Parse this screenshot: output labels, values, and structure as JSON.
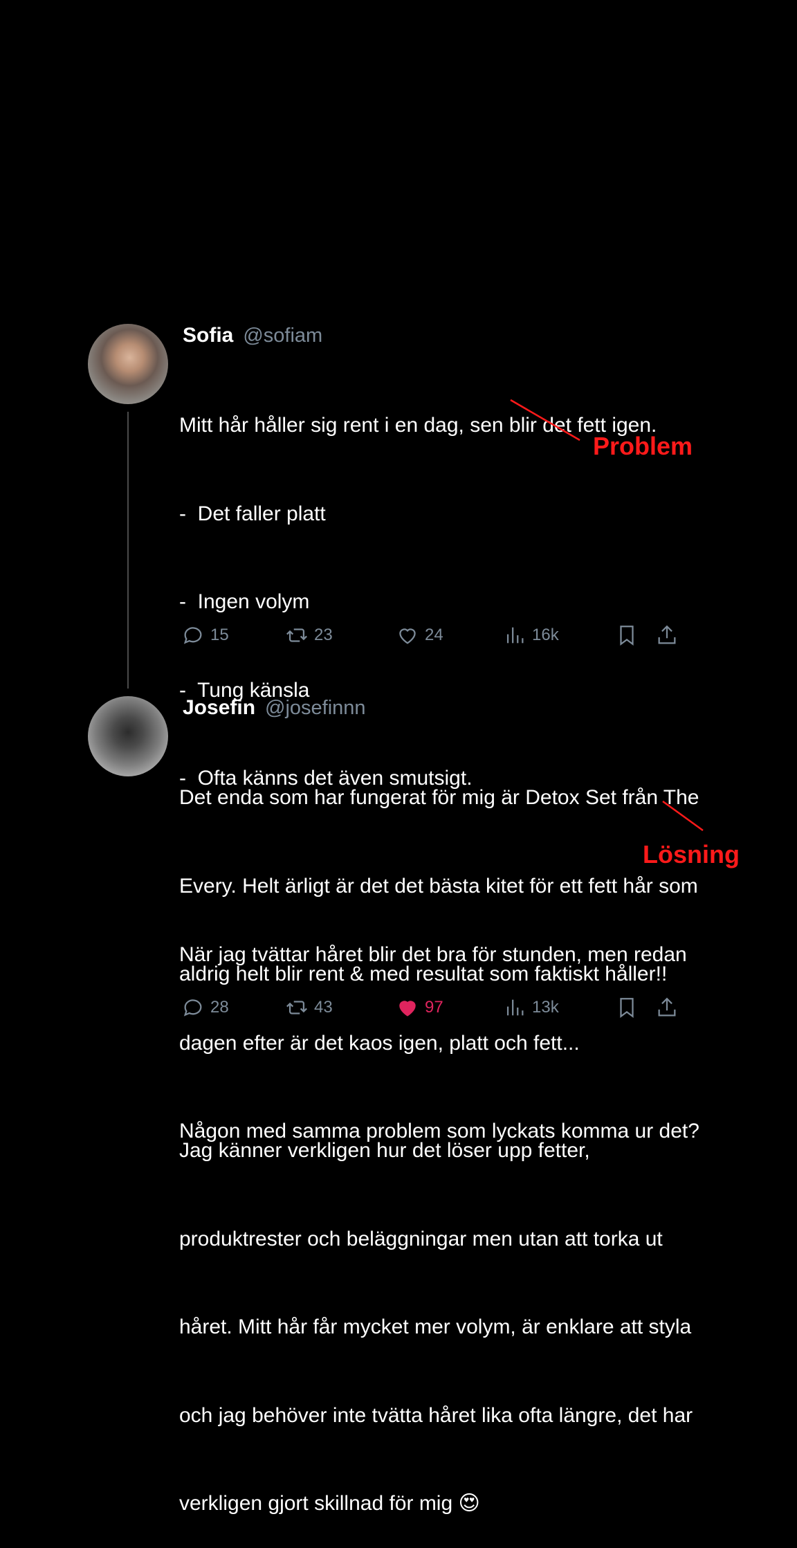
{
  "tweet1": {
    "name": "Sofia",
    "handle": "@sofiam",
    "lines": [
      "Mitt hår håller sig rent i en dag, sen blir det fett igen.",
      "-  Det faller platt",
      "-  Ingen volym",
      "-  Tung känsla",
      "-  Ofta känns det även smutsigt.",
      "",
      "När jag tvättar håret blir det bra för stunden, men redan",
      "dagen efter är det kaos igen, platt och fett...",
      "Någon med samma problem som lyckats komma ur det?"
    ],
    "replies": "15",
    "retweets": "23",
    "likes": "24",
    "views": "16k"
  },
  "tweet2": {
    "name": "Josefin",
    "handle": "@josefinnn",
    "lines": [
      "Det enda som har fungerat för mig är Detox Set från The",
      "Every. Helt ärligt är det det bästa kitet för ett fett hår som",
      "aldrig helt blir rent & med resultat som faktiskt håller!!",
      "",
      "Jag känner verkligen hur det löser upp fetter,",
      "produktrester och beläggningar men utan att torka ut",
      "håret. Mitt hår får mycket mer volym, är enklare att styla",
      "och jag behöver inte tvätta håret lika ofta längre, det har",
      "verkligen gjort skillnad för mig 😍"
    ],
    "replies": "28",
    "retweets": "43",
    "likes": "97",
    "views": "13k"
  },
  "annotations": {
    "problem": "Problem",
    "solution": "Lösning"
  },
  "colors": {
    "background": "#000000",
    "muted": "#7d8b99",
    "like": "#e0245e",
    "annotation": "#ff1a1a"
  },
  "icons": [
    "reply-icon",
    "retweet-icon",
    "heart-icon",
    "views-icon",
    "bookmark-icon",
    "share-icon"
  ]
}
